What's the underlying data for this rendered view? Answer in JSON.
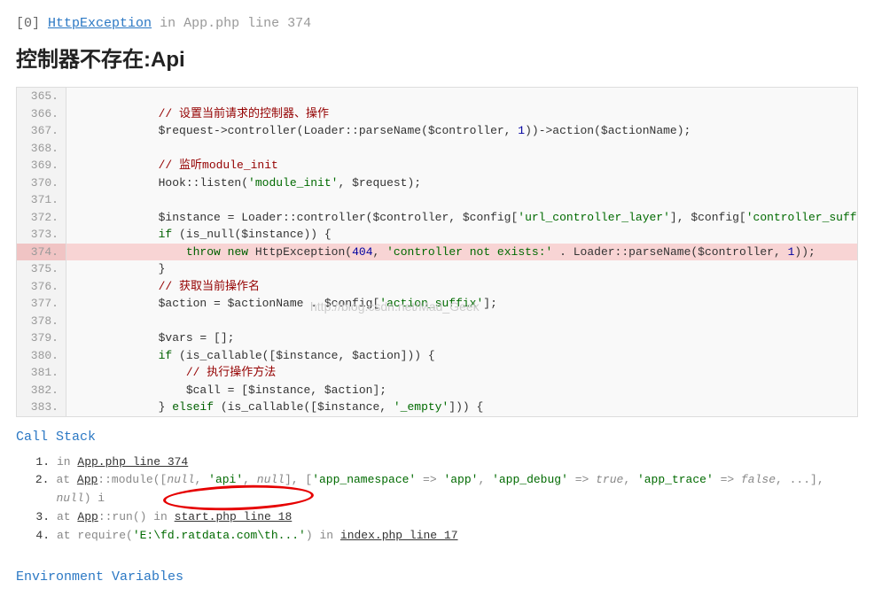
{
  "header": {
    "index": "[0]",
    "exception": "HttpException",
    "in": "in",
    "file": "App.php line 374"
  },
  "title": "控制器不存在:Api",
  "watermark": "http://blog.csdn.net/Mad_Geek",
  "code": {
    "lines": [
      {
        "n": "365.",
        "content": "",
        "hl": false
      },
      {
        "n": "366.",
        "content": "            // 设置当前请求的控制器、操作",
        "type": "comment",
        "hl": false
      },
      {
        "n": "367.",
        "content": "            $request->controller(Loader::parseName($controller, 1))->action($actionName);",
        "hl": false
      },
      {
        "n": "368.",
        "content": "",
        "hl": false
      },
      {
        "n": "369.",
        "content": "            // 监听module_init",
        "type": "comment",
        "hl": false
      },
      {
        "n": "370.",
        "content": "            Hook::listen('module_init', $request);",
        "hl": false
      },
      {
        "n": "371.",
        "content": "",
        "hl": false
      },
      {
        "n": "372.",
        "content": "            $instance = Loader::controller($controller, $config['url_controller_layer'], $config['controller_suffix'], $con",
        "hl": false
      },
      {
        "n": "373.",
        "content": "            if (is_null($instance)) {",
        "hl": false
      },
      {
        "n": "374.",
        "content": "                throw new HttpException(404, 'controller not exists:' . Loader::parseName($controller, 1));",
        "hl": true
      },
      {
        "n": "375.",
        "content": "            }",
        "hl": false
      },
      {
        "n": "376.",
        "content": "            // 获取当前操作名",
        "type": "comment",
        "hl": false
      },
      {
        "n": "377.",
        "content": "            $action = $actionName . $config['action_suffix'];",
        "hl": false
      },
      {
        "n": "378.",
        "content": "",
        "hl": false
      },
      {
        "n": "379.",
        "content": "            $vars = [];",
        "hl": false
      },
      {
        "n": "380.",
        "content": "            if (is_callable([$instance, $action])) {",
        "hl": false
      },
      {
        "n": "381.",
        "content": "                // 执行操作方法",
        "type": "comment",
        "hl": false
      },
      {
        "n": "382.",
        "content": "                $call = [$instance, $action];",
        "hl": false
      },
      {
        "n": "383.",
        "content": "            } elseif (is_callable([$instance, '_empty'])) {",
        "hl": false
      }
    ]
  },
  "callStack": {
    "title": "Call Stack",
    "items": [
      {
        "n": "1.",
        "html": "in <span class='cs-link'>App.php line 374</span>"
      },
      {
        "n": "2.",
        "html": "at <span class='cs-link'>App</span>::module([<span class='cs-null'>null</span>, <span class='cs-str'>'api'</span>, <span class='cs-null'>null</span>], [<span class='cs-str'>'app_namespace'</span> =&gt; <span class='cs-str'>'app'</span>, <span class='cs-str'>'app_debug'</span> =&gt; <span class='cs-true'>true</span>, <span class='cs-str'>'app_trace'</span> =&gt; <span class='cs-false'>false</span>, ...], <span class='cs-null'>null</span>) i"
      },
      {
        "n": "3.",
        "html": "at <span class='cs-link'>App</span>::run() in <span class='cs-link'>start.php line 18</span>"
      },
      {
        "n": "4.",
        "html": "at require(<span class='cs-str'>'E:\\fd.ratdata.com\\th...'</span>) in <span class='cs-link'>index.php line 17</span>"
      }
    ]
  },
  "envVars": {
    "title": "Environment Variables"
  }
}
